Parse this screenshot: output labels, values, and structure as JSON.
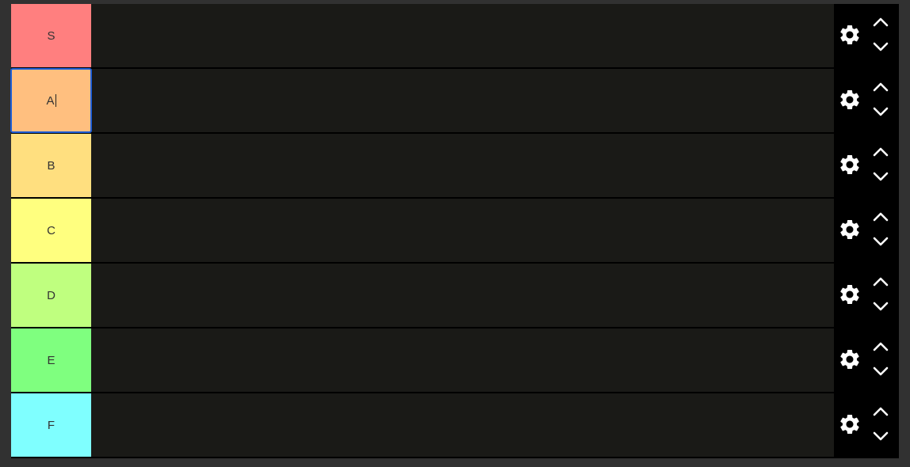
{
  "tiers": [
    {
      "label": "S",
      "color": "#ff7f7f"
    },
    {
      "label": "A",
      "color": "#ffbf7f"
    },
    {
      "label": "B",
      "color": "#ffdf7f"
    },
    {
      "label": "C",
      "color": "#ffff7f"
    },
    {
      "label": "D",
      "color": "#bfff7f"
    },
    {
      "label": "E",
      "color": "#7fff7f"
    },
    {
      "label": "F",
      "color": "#7fffff"
    }
  ],
  "editing_tier_index": 1,
  "icons": {
    "settings": "gear-icon",
    "move_up": "chevron-up-icon",
    "move_down": "chevron-down-icon"
  }
}
